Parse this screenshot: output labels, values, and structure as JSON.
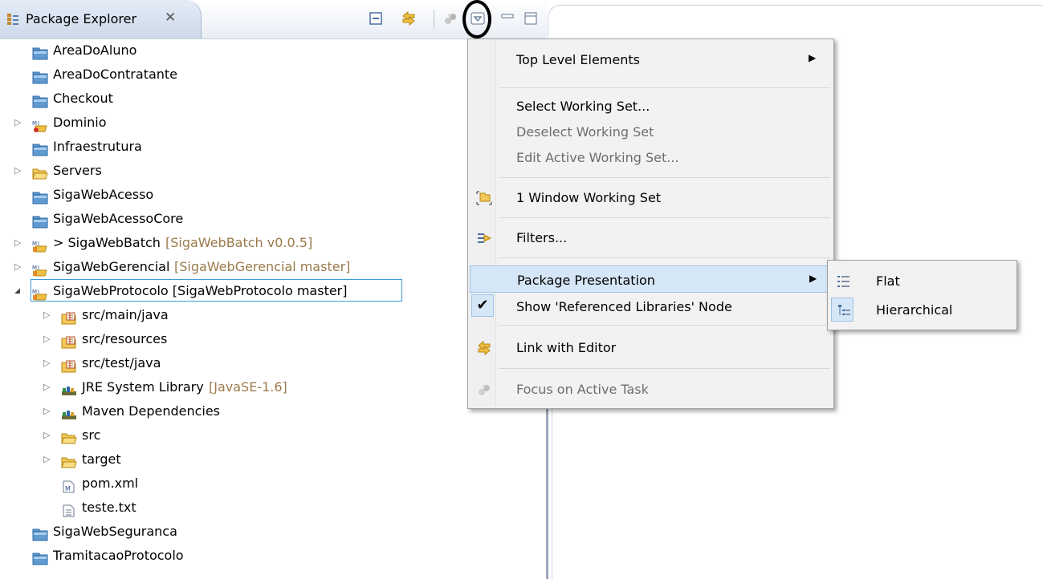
{
  "view": {
    "tab_title": "Package Explorer",
    "tab_close_glyph": "✕",
    "icons": [
      "package-explorer-icon",
      "collapse-all-icon",
      "link-with-editor-icon",
      "focus-task-icon",
      "view-menu-icon",
      "minimize-icon",
      "maximize-icon"
    ]
  },
  "tree": {
    "items": [
      {
        "label": "AreaDoAluno",
        "decoration": "",
        "icon": "closed-project-icon",
        "expander": ""
      },
      {
        "label": "AreaDoContratante",
        "decoration": "",
        "icon": "closed-project-icon",
        "expander": ""
      },
      {
        "label": "Checkout",
        "decoration": "",
        "icon": "closed-project-icon",
        "expander": ""
      },
      {
        "label": "Dominio",
        "decoration": "",
        "icon": "maven-project-error-icon",
        "expander": "▷"
      },
      {
        "label": "Infraestrutura",
        "decoration": "",
        "icon": "closed-project-icon",
        "expander": ""
      },
      {
        "label": "Servers",
        "decoration": "",
        "icon": "open-folder-icon",
        "expander": "▷"
      },
      {
        "label": "SigaWebAcesso",
        "decoration": "",
        "icon": "closed-project-icon",
        "expander": ""
      },
      {
        "label": "SigaWebAcessoCore",
        "decoration": "",
        "icon": "closed-project-icon",
        "expander": ""
      },
      {
        "label": "> SigaWebBatch",
        "decoration": "[SigaWebBatch v0.0.5]",
        "icon": "maven-git-project-icon",
        "expander": "▷"
      },
      {
        "label": "SigaWebGerencial",
        "decoration": "[SigaWebGerencial master]",
        "icon": "maven-git-project-icon",
        "expander": "▷"
      },
      {
        "label": "SigaWebProtocolo [SigaWebProtocolo master]",
        "decoration": "",
        "icon": "maven-git-project-icon",
        "expander": "◢"
      },
      {
        "label": "src/main/java",
        "decoration": "",
        "icon": "source-folder-icon",
        "expander": "▷"
      },
      {
        "label": "src/resources",
        "decoration": "",
        "icon": "source-folder-icon",
        "expander": "▷"
      },
      {
        "label": "src/test/java",
        "decoration": "",
        "icon": "source-folder-icon",
        "expander": "▷"
      },
      {
        "label": "JRE System Library",
        "decoration": "[JavaSE-1.6]",
        "icon": "library-icon",
        "expander": "▷"
      },
      {
        "label": "Maven Dependencies",
        "decoration": "",
        "icon": "library-icon",
        "expander": "▷"
      },
      {
        "label": "src",
        "decoration": "",
        "icon": "folder-icon",
        "expander": "▷"
      },
      {
        "label": "target",
        "decoration": "",
        "icon": "folder-icon",
        "expander": "▷"
      },
      {
        "label": "pom.xml",
        "decoration": "",
        "icon": "maven-pom-icon",
        "expander": ""
      },
      {
        "label": "teste.txt",
        "decoration": "",
        "icon": "text-file-icon",
        "expander": ""
      },
      {
        "label": "SigaWebSeguranca",
        "decoration": "",
        "icon": "closed-project-icon",
        "expander": ""
      },
      {
        "label": "TramitacaoProtocolo",
        "decoration": "",
        "icon": "closed-project-icon",
        "expander": ""
      }
    ]
  },
  "menu": {
    "items": [
      {
        "label": "Top Level Elements",
        "has_submenu": true,
        "enabled": true
      },
      {
        "label": "Select Working Set...",
        "enabled": true
      },
      {
        "label": "Deselect Working Set",
        "enabled": false
      },
      {
        "label": "Edit Active Working Set...",
        "enabled": false
      },
      {
        "label": "1 Window Working Set",
        "enabled": true,
        "icon": "working-set-icon"
      },
      {
        "label": "Filters...",
        "enabled": true,
        "icon": "filter-icon"
      },
      {
        "label": "Package Presentation",
        "has_submenu": true,
        "enabled": true,
        "highlighted": true
      },
      {
        "label": "Show 'Referenced Libraries' Node",
        "enabled": true,
        "checked": true
      },
      {
        "label": "Link with Editor",
        "enabled": true,
        "icon": "link-with-editor-icon"
      },
      {
        "label": "Focus on Active Task",
        "enabled": false,
        "icon": "focus-task-icon"
      }
    ],
    "submenu_arrow": "▶",
    "check_glyph": "✔"
  },
  "submenu": {
    "items": [
      {
        "label": "Flat",
        "icon": "flat-layout-icon",
        "selected": false
      },
      {
        "label": "Hierarchical",
        "icon": "hierarchical-layout-icon",
        "selected": true
      }
    ]
  },
  "colors": {
    "selection_border": "#3a9ad9",
    "menu_highlight": "#d5e6f7",
    "decoration_text": "#9b7a4b",
    "disabled_text": "#6d6d6d"
  }
}
